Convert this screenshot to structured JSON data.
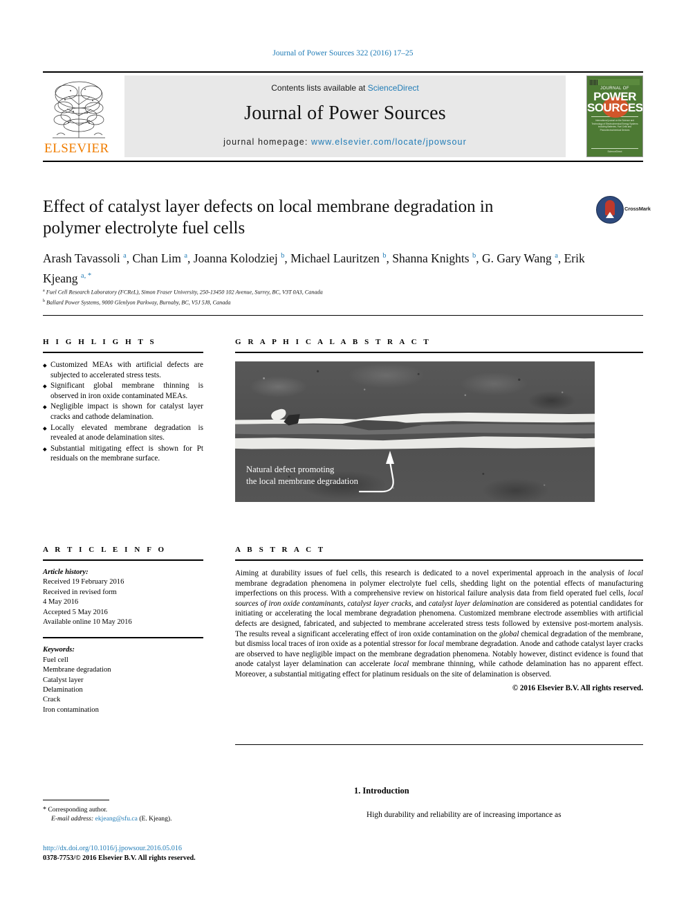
{
  "running_head": "Journal of Power Sources 322 (2016) 17–25",
  "masthead": {
    "contents_label": "Contents lists available at",
    "sciencedirect": "ScienceDirect",
    "journal_title": "Journal of Power Sources",
    "homepage_label": "journal homepage:",
    "homepage_url": "www.elsevier.com/locate/jpowsour",
    "publisher": "ELSEVIER",
    "cover": {
      "line1": "JOURNAL OF",
      "line2": "POWER",
      "line3": "SOURCES",
      "desc": "International journal on the Science and Technology of Electrochemical Energy Systems including Batteries, Fuel Cells and Photoelectrochemical Devices",
      "footer": "ScienceDirect"
    }
  },
  "article": {
    "title": "Effect of catalyst layer defects on local membrane degradation in polymer electrolyte fuel cells",
    "crossmark_label": "CrossMark",
    "authors": [
      {
        "name": "Arash Tavassoli",
        "marks": "a"
      },
      {
        "name": "Chan Lim",
        "marks": "a"
      },
      {
        "name": "Joanna Kolodziej",
        "marks": "b"
      },
      {
        "name": "Michael Lauritzen",
        "marks": "b"
      },
      {
        "name": "Shanna Knights",
        "marks": "b"
      },
      {
        "name": "G. Gary Wang",
        "marks": "a"
      },
      {
        "name": "Erik Kjeang",
        "marks": "a, *"
      }
    ],
    "affiliations": [
      {
        "mark": "a",
        "text": "Fuel Cell Research Laboratory (FCReL), Simon Fraser University, 250-13450 102 Avenue, Surrey, BC, V3T 0A3, Canada"
      },
      {
        "mark": "b",
        "text": "Ballard Power Systems, 9000 Glenlyon Parkway, Burnaby, BC, V5J 5J8, Canada"
      }
    ]
  },
  "highlights": {
    "heading": "H I G H L I G H T S",
    "items": [
      "Customized MEAs with artificial defects are subjected to accelerated stress tests.",
      "Significant global membrane thinning is observed in iron oxide contaminated MEAs.",
      "Negligible impact is shown for catalyst layer cracks and cathode delamination.",
      "Locally elevated membrane degradation is revealed at anode delamination sites.",
      "Substantial mitigating effect is shown for Pt residuals on the membrane surface."
    ]
  },
  "graphical_abstract": {
    "heading": "G R A P H I C A L   A B S T R A C T",
    "annotation_line1": "Natural defect promoting",
    "annotation_line2": "the local membrane degradation"
  },
  "article_info": {
    "heading": "A R T I C L E   I N F O",
    "history_label": "Article history:",
    "history": [
      "Received 19 February 2016",
      "Received in revised form",
      "4 May 2016",
      "Accepted 5 May 2016",
      "Available online 10 May 2016"
    ],
    "keywords_label": "Keywords:",
    "keywords": [
      "Fuel cell",
      "Membrane degradation",
      "Catalyst layer",
      "Delamination",
      "Crack",
      "Iron contamination"
    ]
  },
  "abstract": {
    "heading": "A B S T R A C T",
    "paragraph_1": "Aiming at durability issues of fuel cells, this research is dedicated to a novel experimental approach in the analysis of ",
    "em_1": "local",
    "paragraph_2": " membrane degradation phenomena in polymer electrolyte fuel cells, shedding light on the potential effects of manufacturing imperfections on this process. With a comprehensive review on historical failure analysis data from field operated fuel cells, ",
    "em_2": "local sources of iron oxide contaminants, catalyst layer cracks,",
    "paragraph_3": " and ",
    "em_3": "catalyst layer delamination",
    "paragraph_4": " are considered as potential candidates for initiating or accelerating the local membrane degradation phenomena. Customized membrane electrode assemblies with artificial defects are designed, fabricated, and subjected to membrane accelerated stress tests followed by extensive post-mortem analysis. The results reveal a significant accelerating effect of iron oxide contamination on the ",
    "em_4": "global",
    "paragraph_5": " chemical degradation of the membrane, but dismiss local traces of iron oxide as a potential stressor for ",
    "em_5": "local",
    "paragraph_6": " membrane degradation. Anode and cathode catalyst layer cracks are observed to have negligible impact on the membrane degradation phenomena. Notably however, distinct evidence is found that anode catalyst layer delamination can accelerate ",
    "em_6": "local",
    "paragraph_7": " membrane thinning, while cathode delamination has no apparent effect. Moreover, a substantial mitigating effect for platinum residuals on the site of delamination is observed.",
    "copyright": "© 2016 Elsevier B.V. All rights reserved."
  },
  "footer": {
    "corresponding_star": "*",
    "corresponding_label": "Corresponding author.",
    "email_label": "E-mail address:",
    "email": "ekjeang@sfu.ca",
    "email_suffix": "(E. Kjeang).",
    "doi": "http://dx.doi.org/10.1016/j.jpowsour.2016.05.016",
    "issn_line": "0378-7753/© 2016 Elsevier B.V. All rights reserved."
  },
  "introduction": {
    "heading": "1. Introduction",
    "first_paragraph": "High durability and reliability are of increasing importance as"
  }
}
